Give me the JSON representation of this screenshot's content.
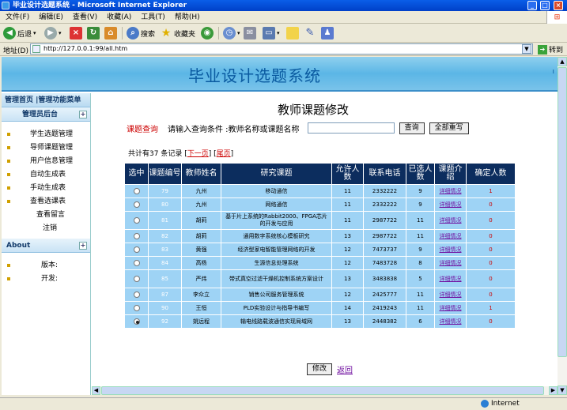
{
  "window": {
    "title": "毕业设计选题系统 - Microsoft Internet Explorer"
  },
  "menu": [
    "文件(F)",
    "编辑(E)",
    "查看(V)",
    "收藏(A)",
    "工具(T)",
    "帮助(H)"
  ],
  "toolbar": {
    "back": "后退",
    "search": "搜索",
    "favorites": "收藏夹"
  },
  "address": {
    "label": "地址(D)",
    "url": "http://127.0.0.1:99/all.htm",
    "go": "转到"
  },
  "header": {
    "title": "毕业设计选题系统"
  },
  "sidebar": {
    "top": "管理首页 |管理功能菜单",
    "section1": "管理员后台",
    "items": [
      "学生选题管理",
      "导师课题管理",
      "用户信息管理",
      "自动生成表",
      "手动生成表",
      "查看选课表"
    ],
    "sub_items": [
      "查看留言",
      "注销"
    ],
    "section2": "About",
    "about_items": [
      "版本:",
      "开发:"
    ]
  },
  "main": {
    "title": "教师课题修改",
    "search_label": "课题查询",
    "search_prompt": "请输入查询条件 :教师名称或课题名称",
    "search_button": "查询",
    "reset_button": "全部重写",
    "count_prefix": "共计有37 条记录",
    "next": "下一页",
    "last": "尾页",
    "modify_button": "修改",
    "back_link": "返回"
  },
  "table": {
    "headers": [
      "选中",
      "课题编号",
      "教师姓名",
      "研究课题",
      "允许人数",
      "联系电话",
      "已选人数",
      "课题介绍",
      "确定人数"
    ],
    "rows": [
      {
        "no": "79",
        "teacher": "九州",
        "topic": "移动通信",
        "allow": "11",
        "phone": "2332222",
        "chosen": "9",
        "intro": "详细情况",
        "confirmed": "1",
        "selected": false
      },
      {
        "no": "80",
        "teacher": "九州",
        "topic": "网络通信",
        "allow": "11",
        "phone": "2332222",
        "chosen": "9",
        "intro": "详细情况",
        "confirmed": "0",
        "selected": false
      },
      {
        "no": "81",
        "teacher": "胡莉",
        "topic": "基于片上系统的Rabbit2000、FPGA芯片的开发与应用",
        "allow": "11",
        "phone": "2987722",
        "chosen": "11",
        "intro": "详细情况",
        "confirmed": "0",
        "selected": false
      },
      {
        "no": "82",
        "teacher": "胡莉",
        "topic": "通用数字系统核心模板研究",
        "allow": "13",
        "phone": "2987722",
        "chosen": "11",
        "intro": "详细情况",
        "confirmed": "0",
        "selected": false
      },
      {
        "no": "83",
        "teacher": "黄强",
        "topic": "经济型家电智能管理网络的开发",
        "allow": "12",
        "phone": "7473737",
        "chosen": "9",
        "intro": "详细情况",
        "confirmed": "0",
        "selected": false
      },
      {
        "no": "84",
        "teacher": "高杨",
        "topic": "生源信息处理系统",
        "allow": "12",
        "phone": "7483728",
        "chosen": "8",
        "intro": "详细情况",
        "confirmed": "0",
        "selected": false
      },
      {
        "no": "85",
        "teacher": "严炜",
        "topic": "带式真空过滤干燥机控制系统方案设计",
        "allow": "13",
        "phone": "3483838",
        "chosen": "5",
        "intro": "详细情况",
        "confirmed": "0",
        "selected": false
      },
      {
        "no": "87",
        "teacher": "李众立",
        "topic": "销售公司服务管理系统",
        "allow": "12",
        "phone": "2425777",
        "chosen": "11",
        "intro": "详细情况",
        "confirmed": "0",
        "selected": false
      },
      {
        "no": "90",
        "teacher": "王恒",
        "topic": "PLD实验设计与指导书编写",
        "allow": "14",
        "phone": "2419243",
        "chosen": "11",
        "intro": "详细情况",
        "confirmed": "1",
        "selected": false
      },
      {
        "no": "92",
        "teacher": "姚远程",
        "topic": "输电线路载波通信实现局域网",
        "allow": "13",
        "phone": "2448382",
        "chosen": "6",
        "intro": "详细情况",
        "confirmed": "0",
        "selected": true
      }
    ]
  },
  "status": {
    "zone": "Internet"
  }
}
